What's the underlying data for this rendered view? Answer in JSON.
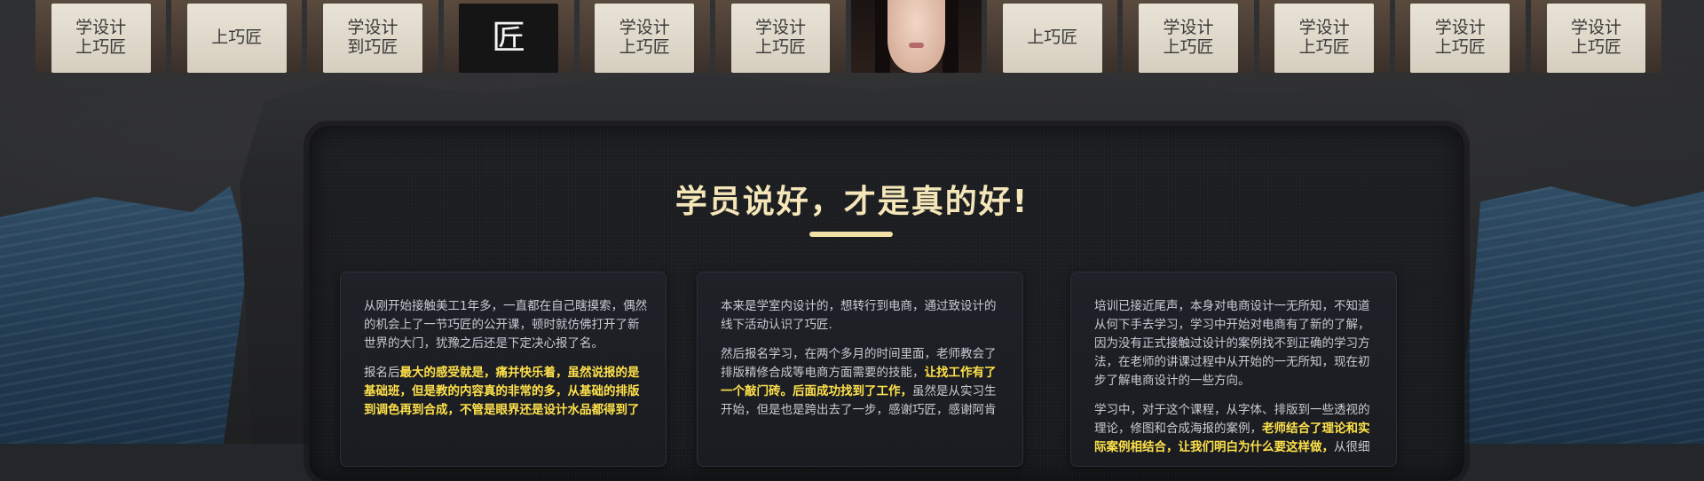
{
  "photo_strip": [
    {
      "sign": [
        "学设计",
        "上巧匠"
      ],
      "style": "paper"
    },
    {
      "sign": [
        "上巧匠"
      ],
      "style": "paper"
    },
    {
      "sign": [
        "学设计",
        "到巧匠"
      ],
      "style": "paper"
    },
    {
      "sign": [
        "匠"
      ],
      "style": "dark"
    },
    {
      "sign": [
        "学设计",
        "上巧匠"
      ],
      "style": "paper"
    },
    {
      "sign": [
        "学设计",
        "上巧匠"
      ],
      "style": "paper"
    },
    {
      "sign": [],
      "style": "face"
    },
    {
      "sign": [
        "上巧匠"
      ],
      "style": "paper"
    },
    {
      "sign": [
        "学设计",
        "上巧匠"
      ],
      "style": "paper"
    },
    {
      "sign": [
        "学设计",
        "上巧匠"
      ],
      "style": "paper"
    },
    {
      "sign": [
        "学设计",
        "上巧匠"
      ],
      "style": "paper"
    },
    {
      "sign": [
        "学设计",
        "上巧匠"
      ],
      "style": "paper"
    }
  ],
  "section": {
    "title": "学员说好，才是真的好!"
  },
  "cards": [
    {
      "paragraphs": [
        [
          {
            "t": "从刚开始接触美工1年多，一直都在自己瞎摸索，偶然的机会上了一节巧匠的公开课，顿时就仿佛打开了新世界的大门，犹豫之后还是下定决心报了名。"
          }
        ],
        [
          {
            "t": "报名后"
          },
          {
            "t": "最大的感受就是，痛并快乐着，虽然说报的是基础班，但是教的内容真的非常的多，从基础的排版到调色再到合成，不管是眼界还是设计水品都得到了",
            "hl": true
          }
        ]
      ]
    },
    {
      "paragraphs": [
        [
          {
            "t": "本来是学室内设计的，想转行到电商，通过致设计的线下活动认识了巧匠."
          }
        ],
        [
          {
            "t": "然后报名学习，在两个多月的时间里面，老师教会了排版精修合成等电商方面需要的技能，"
          },
          {
            "t": "让找工作有了一个敲门砖。后面成功找到了工作，",
            "hl": true
          },
          {
            "t": "虽然是从实习生开始，但是也是跨出去了一步，感谢巧匠，感谢阿肯"
          }
        ]
      ]
    },
    {
      "paragraphs": [
        [
          {
            "t": "培训已接近尾声，本身对电商设计一无所知，不知道从何下手去学习，学习中开始对电商有了新的了解，因为没有正式接触过设计的案例找不到正确的学习方法，在老师的讲课过程中从开始的一无所知，现在初步了解电商设计的一些方向。"
          }
        ],
        [
          {
            "t": "学习中，对于这个课程，从字体、排版到一些透视的理论，修图和合成海报的案例，"
          },
          {
            "t": "老师结合了理论和实际案例相结合，让我们明白为什么要这样做，",
            "hl": true
          },
          {
            "t": "从很细"
          }
        ]
      ]
    }
  ],
  "colors": {
    "title": "#f4e6b8",
    "highlight": "#ffe14a",
    "body_text": "#c8ccd2",
    "sea": "#2f4d66"
  }
}
